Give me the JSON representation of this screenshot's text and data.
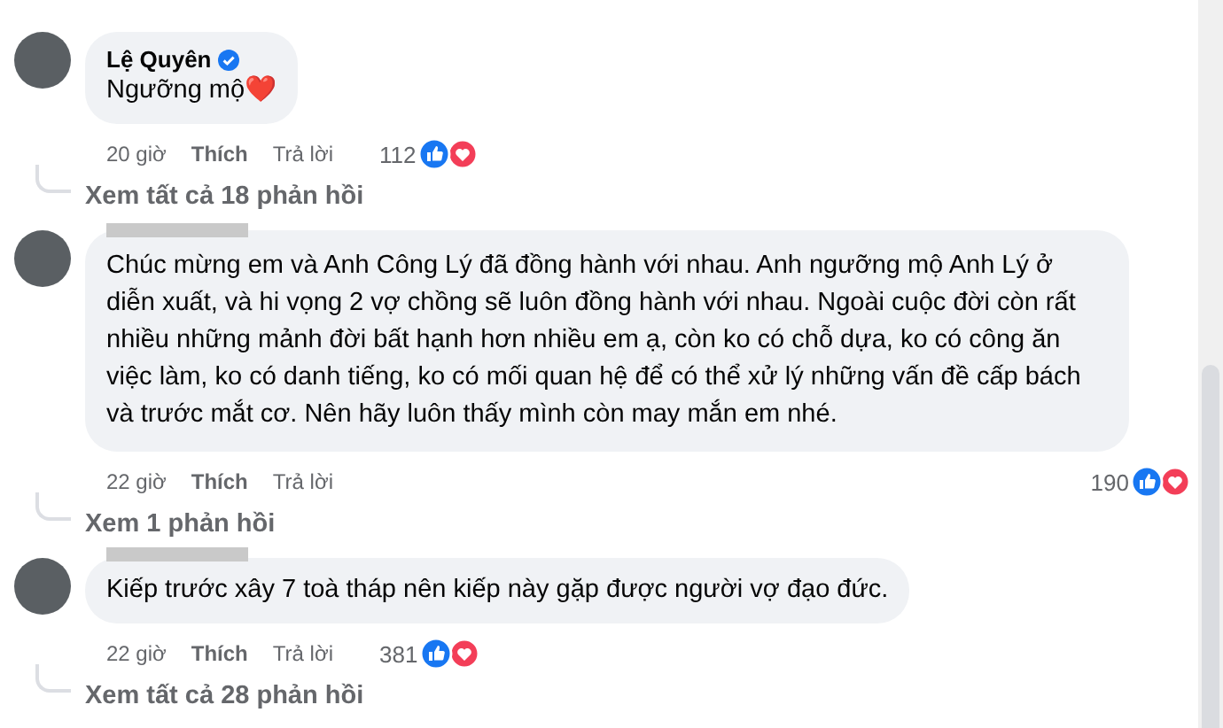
{
  "comments": [
    {
      "author": "Lệ Quyên",
      "verified": true,
      "text": "Ngưỡng mộ❤️",
      "time": "20 giờ",
      "like": "Thích",
      "reply": "Trả lời",
      "reactions": "112",
      "view_replies": "Xem tất cả 18 phản hồi"
    },
    {
      "text": "Chúc mừng em và Anh Công Lý đã đồng hành với nhau. Anh ngưỡng mộ Anh Lý ở diễn xuất, và hi vọng 2 vợ chồng sẽ luôn đồng hành với nhau. Ngoài cuộc đời còn rất nhiều những mảnh đời bất hạnh hơn nhiều em ạ, còn ko có chỗ dựa, ko có công ăn việc làm, ko có danh tiếng, ko có mối quan hệ để có thể xử lý những vấn đề cấp bách và trước mắt cơ. Nên hãy luôn thấy mình còn may mắn em nhé.",
      "time": "22 giờ",
      "like": "Thích",
      "reply": "Trả lời",
      "reactions": "190",
      "view_replies": "Xem 1 phản hồi"
    },
    {
      "text": "Kiếp trước xây 7 toà tháp nên kiếp này gặp được người vợ đạo đức.",
      "time": "22 giờ",
      "like": "Thích",
      "reply": "Trả lời",
      "reactions": "381",
      "view_replies": "Xem tất cả 28 phản hồi"
    }
  ]
}
